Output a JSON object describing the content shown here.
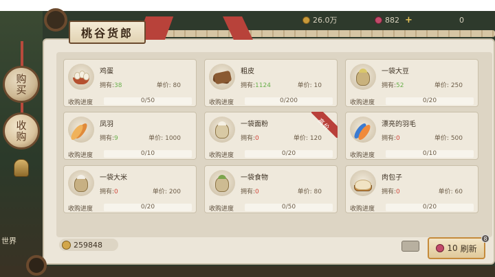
{
  "resources": {
    "silver": "26.0万",
    "gems": "882",
    "plus": "+",
    "third": "0"
  },
  "sidebar": {
    "buy": "购买",
    "purchase": "收购",
    "world": "世界"
  },
  "title": "桃谷货郎",
  "labels": {
    "own": "拥有:",
    "price": "单价:",
    "progress": "收购进度"
  },
  "hot_tag": "高价",
  "items": [
    {
      "name": "鸡蛋",
      "owned": "38",
      "price": "80",
      "progress": "0/50",
      "fraction": 0,
      "icon": "egg-icon"
    },
    {
      "name": "粗皮",
      "owned": "1124",
      "price": "10",
      "progress": "0/200",
      "fraction": 0,
      "icon": "hide-icon"
    },
    {
      "name": "一袋大豆",
      "owned": "52",
      "price": "250",
      "progress": "0/20",
      "fraction": 0,
      "icon": "soybean-sack-icon"
    },
    {
      "name": "凤羽",
      "owned": "9",
      "price": "1000",
      "progress": "0/10",
      "fraction": 0,
      "icon": "phoenix-feather-icon"
    },
    {
      "name": "一袋面粉",
      "owned": "0",
      "price": "120",
      "progress": "0/20",
      "fraction": 0,
      "icon": "flour-sack-icon",
      "hot": true
    },
    {
      "name": "漂亮的羽毛",
      "owned": "0",
      "price": "500",
      "progress": "0/10",
      "fraction": 0,
      "icon": "pretty-feather-icon"
    },
    {
      "name": "一袋大米",
      "owned": "0",
      "price": "200",
      "progress": "0/20",
      "fraction": 0,
      "icon": "rice-sack-icon"
    },
    {
      "name": "一袋食物",
      "owned": "0",
      "price": "80",
      "progress": "0/50",
      "fraction": 0,
      "icon": "food-sack-icon"
    },
    {
      "name": "肉包子",
      "owned": "0",
      "price": "60",
      "progress": "0/20",
      "fraction": 0,
      "icon": "meat-bun-icon"
    }
  ],
  "footer": {
    "coins": "259848",
    "refresh_cost": "10",
    "refresh_label": "刷新",
    "refresh_badge": "8"
  },
  "colors": {
    "owned_positive": "#6ab04c",
    "owned_zero": "#d0463a",
    "hot_tag": "#b9403a"
  }
}
